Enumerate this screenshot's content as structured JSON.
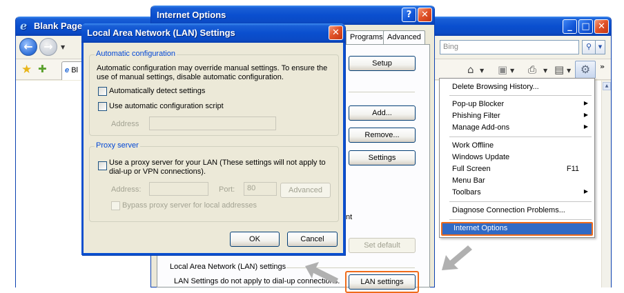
{
  "ie_window": {
    "title": "Blank Page",
    "search_placeholder": "Bing",
    "tab_label": "Bl"
  },
  "inet_options": {
    "title": "Internet Options",
    "tabs": [
      "Programs",
      "Advanced"
    ],
    "buttons": {
      "setup": "Setup",
      "add": "Add...",
      "remove": "Remove...",
      "settings": "Settings",
      "set_default": "Set default",
      "lan_settings": "LAN settings"
    },
    "partial_text": "nt",
    "lan_group_title": "Local Area Network (LAN) settings",
    "lan_note": "LAN Settings do not apply to dial-up connections."
  },
  "lan_dialog": {
    "title": "Local Area Network (LAN) Settings",
    "auto_config": {
      "legend": "Automatic configuration",
      "description_line1": "Automatic configuration may override manual settings.  To ensure the",
      "description_line2": "use of manual settings, disable automatic configuration.",
      "auto_detect_label": "Automatically detect settings",
      "auto_detect_checked": false,
      "use_script_label": "Use automatic configuration script",
      "use_script_checked": false,
      "address_label": "Address",
      "address_value": ""
    },
    "proxy": {
      "legend": "Proxy server",
      "use_proxy_line1": "Use a proxy server for your LAN (These settings will not apply to",
      "use_proxy_line2": "dial-up or VPN connections).",
      "use_proxy_checked": false,
      "address_label": "Address:",
      "address_value": "",
      "port_label": "Port:",
      "port_value": "80",
      "advanced_label": "Advanced",
      "bypass_label": "Bypass proxy server for local addresses",
      "bypass_checked": false
    },
    "ok_label": "OK",
    "cancel_label": "Cancel"
  },
  "tools_menu": {
    "items": [
      {
        "label": "Delete Browsing History...",
        "shortcut": "",
        "submenu": false
      },
      {
        "label": "Pop-up Blocker",
        "shortcut": "",
        "submenu": true
      },
      {
        "label": "Phishing Filter",
        "shortcut": "",
        "submenu": true
      },
      {
        "label": "Manage Add-ons",
        "shortcut": "",
        "submenu": true
      },
      {
        "label": "Work Offline",
        "shortcut": "",
        "submenu": false
      },
      {
        "label": "Windows Update",
        "shortcut": "",
        "submenu": false
      },
      {
        "label": "Full Screen",
        "shortcut": "F11",
        "submenu": false
      },
      {
        "label": "Menu Bar",
        "shortcut": "",
        "submenu": false
      },
      {
        "label": "Toolbars",
        "shortcut": "",
        "submenu": true
      },
      {
        "label": "Diagnose Connection Problems...",
        "shortcut": "",
        "submenu": false
      },
      {
        "label": "Internet Options",
        "shortcut": "",
        "submenu": false,
        "selected": true
      }
    ]
  },
  "icons": {
    "back": "back-arrow-icon",
    "forward": "forward-arrow-icon",
    "favorites": "favorites-star-icon",
    "add_favorites": "add-favorites-icon",
    "home": "home-icon",
    "feeds": "feeds-icon",
    "print": "print-icon",
    "page": "page-icon",
    "tools": "gear-icon",
    "search": "search-icon",
    "help": "help-icon",
    "close": "close-icon",
    "minimize": "minimize-icon",
    "maximize": "maximize-icon"
  },
  "colors": {
    "titlebar_blue": "#0a4fcf",
    "highlight_orange": "#ef6b1a",
    "selection_blue": "#316ac5",
    "groupbox_legend": "#0046d5"
  }
}
